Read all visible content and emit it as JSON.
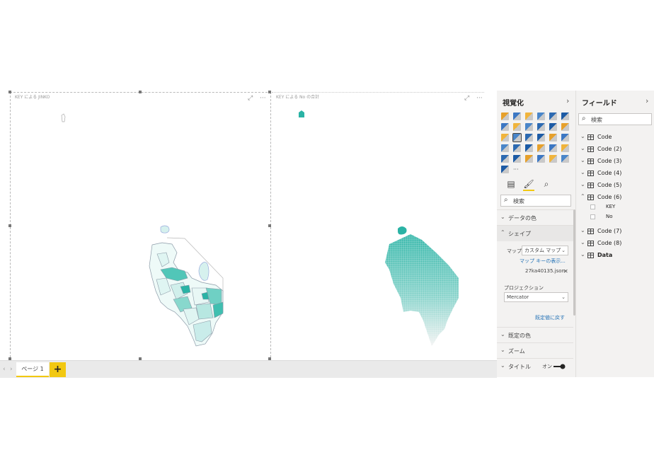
{
  "visuals": [
    {
      "title": "KEY による JINKO"
    },
    {
      "title": "KEY による No の合計"
    }
  ],
  "page_tabs": {
    "active": "ページ 1",
    "add_label": "+"
  },
  "visualizations": {
    "header": "視覚化",
    "search_placeholder": "検索",
    "more_label": "···",
    "sections": {
      "data_colors": "データの色",
      "shape": "シェイプ",
      "default_colors": "既定の色",
      "zoom": "ズーム",
      "title": "タイトル"
    },
    "shape": {
      "map_label": "マップ",
      "map_value": "カスタム マップ",
      "view_map_keys": "マップ キーの表示...",
      "file_name": "27ka40135.json",
      "projection_label": "プロジェクション",
      "projection_value": "Mercator",
      "reset_default": "既定値に戻す"
    },
    "title_toggle": "オン"
  },
  "fields": {
    "header": "フィールド",
    "search_placeholder": "検索",
    "tables": [
      {
        "name": "Code"
      },
      {
        "name": "Code (2)"
      },
      {
        "name": "Code (3)"
      },
      {
        "name": "Code (4)"
      },
      {
        "name": "Code (5)"
      },
      {
        "name": "Code (6)",
        "expanded": true,
        "columns": [
          "KEY",
          "No"
        ]
      },
      {
        "name": "Code (7)"
      },
      {
        "name": "Code (8)"
      },
      {
        "name": "Data"
      }
    ]
  },
  "colors": {
    "accent": "#f2c811",
    "teal": "#2ab3a5",
    "teal_light": "#c9ecea"
  }
}
